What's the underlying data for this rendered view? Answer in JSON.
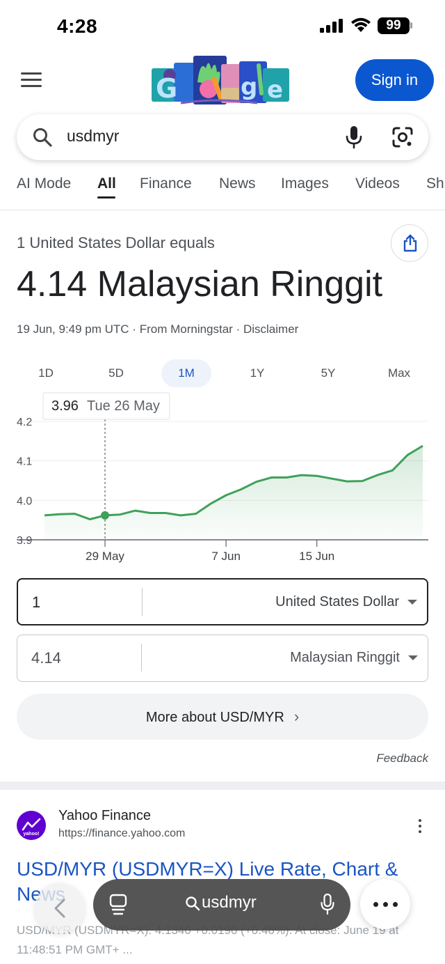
{
  "status_bar": {
    "time": "4:28",
    "battery": "99"
  },
  "header": {
    "sign_in_label": "Sign in"
  },
  "search": {
    "query": "usdmyr"
  },
  "tabs": [
    "AI Mode",
    "All",
    "Finance",
    "News",
    "Images",
    "Videos",
    "Sh"
  ],
  "active_tab": "All",
  "currency": {
    "equals_label": "1 United States Dollar equals",
    "result": "4.14 Malaysian Ringgit",
    "timestamp": "19 Jun, 9:49 pm UTC",
    "source": "From Morningstar",
    "disclaimer": "Disclaimer",
    "ranges": [
      "1D",
      "5D",
      "1M",
      "1Y",
      "5Y",
      "Max"
    ],
    "active_range": "1M"
  },
  "chart_data": {
    "type": "line",
    "series": [
      {
        "values": [
          3.962,
          3.965,
          3.966,
          3.952,
          3.962,
          3.964,
          3.974,
          3.968,
          3.968,
          3.962,
          3.966,
          3.992,
          4.013,
          4.028,
          4.047,
          4.058,
          4.058,
          4.064,
          4.062,
          4.055,
          4.048,
          4.049,
          4.064,
          4.076,
          4.115,
          4.138
        ]
      }
    ],
    "x_tick_labels": [
      "29 May",
      "7 Jun",
      "15 Jun"
    ],
    "y_tick_labels": [
      "4.2",
      "4.1",
      "4.0",
      "3.9"
    ],
    "ylim": [
      3.9,
      4.2
    ],
    "tooltip": {
      "value": "3.96",
      "date": "Tue 26 May"
    },
    "color": "#3fa15a"
  },
  "converter": {
    "from_value": "1",
    "from_unit": "United States Dollar",
    "to_value": "4.14",
    "to_unit": "Malaysian Ringgit"
  },
  "more_label": "More about USD/MYR",
  "feedback_label": "Feedback",
  "result": {
    "site_name": "Yahoo Finance",
    "url": "https://finance.yahoo.com",
    "logo_text": "yahoo!",
    "title": "USD/MYR (USDMYR=X) Live Rate, Chart & News",
    "snippet": "USD/MYR (USDMYR=X): 4.1340 +0.0190 (+0.46%). At close: June 19 at 11:48:51 PM GMT+ ..."
  },
  "bottom_bar": {
    "query": "usdmyr"
  }
}
